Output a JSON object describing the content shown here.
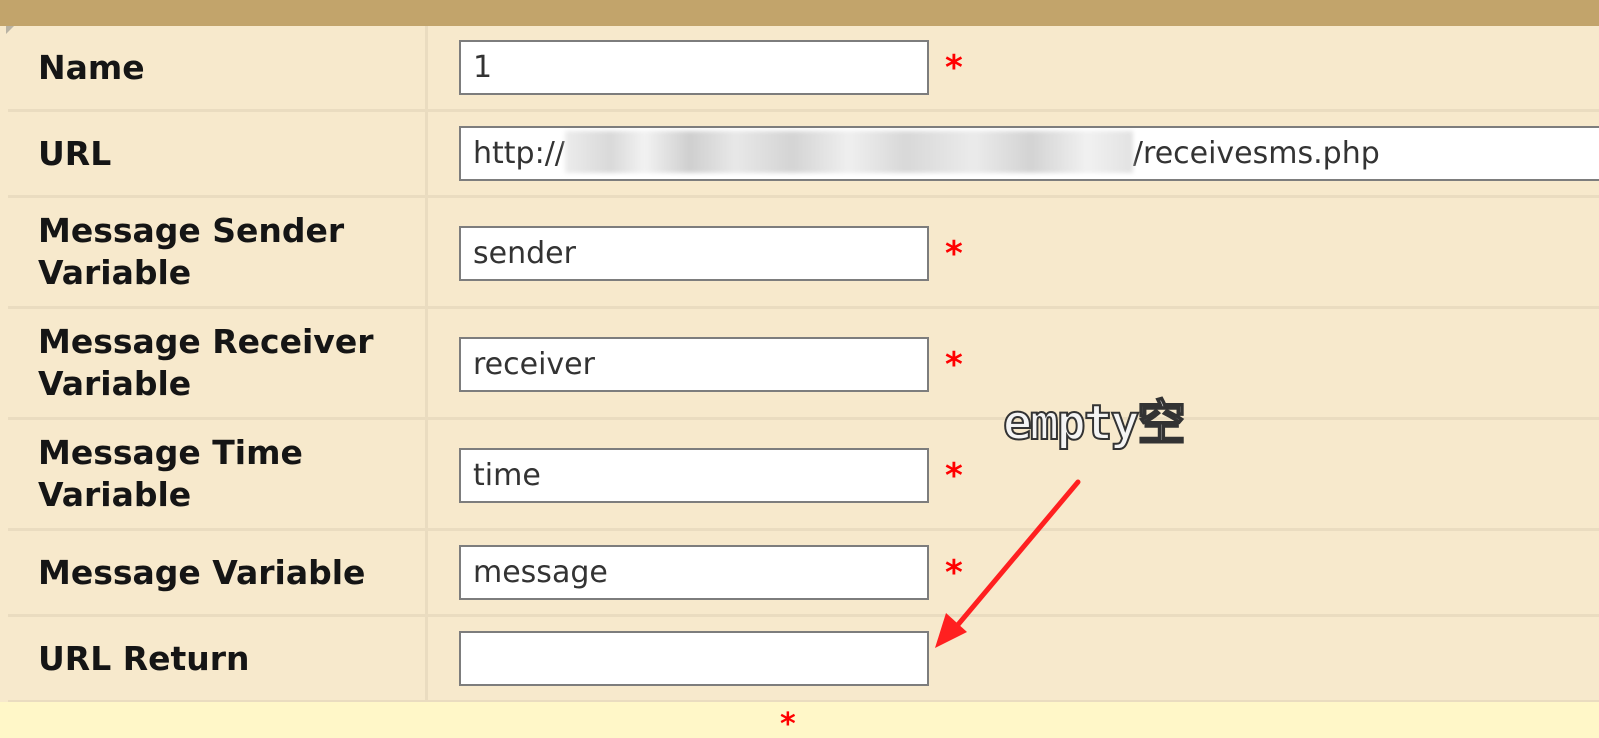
{
  "form": {
    "rows": [
      {
        "label": "Name",
        "value": "1",
        "required": "*"
      },
      {
        "label": "URL",
        "value_prefix": "http://",
        "value_suffix": "/receivesms.php"
      },
      {
        "label": "Message Sender Variable",
        "value": "sender",
        "required": "*"
      },
      {
        "label": "Message Receiver Variable",
        "value": "receiver",
        "required": "*"
      },
      {
        "label": "Message Time Variable",
        "value": "time",
        "required": "*"
      },
      {
        "label": "Message Variable",
        "value": "message",
        "required": "*"
      },
      {
        "label": "URL Return",
        "value": ""
      }
    ]
  },
  "annotation": {
    "text": "empty空",
    "color": "#ff2020"
  },
  "footer": {
    "required_mark": "*"
  },
  "colors": {
    "form_background": "#f7e9cc",
    "header_bar": "#c2a46b",
    "required": "#ff0000",
    "footer_strip": "#fff7c8"
  }
}
